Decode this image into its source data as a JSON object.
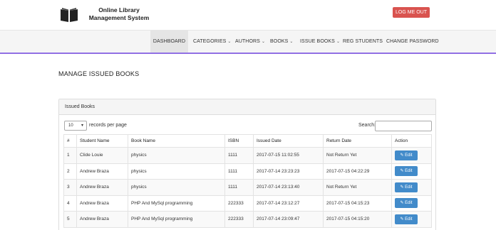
{
  "brand": {
    "title": "Online Library Management System",
    "logo_icon": "book-icon"
  },
  "header": {
    "logout_label": "LOG ME OUT",
    "logout_color": "#d9534f"
  },
  "menu": {
    "accent_color": "#9170e4",
    "items": [
      {
        "label": "DASHBOARD",
        "active": true,
        "dropdown": false
      },
      {
        "label": "CATEGORIES",
        "active": false,
        "dropdown": true
      },
      {
        "label": "AUTHORS",
        "active": false,
        "dropdown": true
      },
      {
        "label": "BOOKS",
        "active": false,
        "dropdown": true
      },
      {
        "label": "ISSUE BOOKS",
        "active": false,
        "dropdown": true
      },
      {
        "label": "REG STUDENTS",
        "active": false,
        "dropdown": false
      },
      {
        "label": "CHANGE PASSWORD",
        "active": false,
        "dropdown": false
      }
    ]
  },
  "page": {
    "title": "MANAGE ISSUED BOOKS"
  },
  "panel": {
    "heading": "Issued Books",
    "length_value": "10",
    "length_label": "records per page",
    "search_label": "Search:",
    "search_value": ""
  },
  "table": {
    "columns": [
      "#",
      "Student Name",
      "Book Name",
      "ISBN",
      "Issued Date",
      "Return Date",
      "Action"
    ],
    "rows": [
      {
        "num": "1",
        "student": "Clide Louie",
        "book": "physics",
        "isbn": "1111",
        "issued": "2017-07-15 11:02:55",
        "returned": "Not Return Yet",
        "action": "Edit"
      },
      {
        "num": "2",
        "student": "Andrew Braza",
        "book": "physics",
        "isbn": "1111",
        "issued": "2017-07-14 23:23:23",
        "returned": "2017-07-15 04:22:29",
        "action": "Edit"
      },
      {
        "num": "3",
        "student": "Andrew Braza",
        "book": "physics",
        "isbn": "1111",
        "issued": "2017-07-14 23:13:40",
        "returned": "Not Return Yet",
        "action": "Edit"
      },
      {
        "num": "4",
        "student": "Andrew Braza",
        "book": "PHP And MySql programming",
        "isbn": "222333",
        "issued": "2017-07-14 23:12:27",
        "returned": "2017-07-15 04:15:23",
        "action": "Edit"
      },
      {
        "num": "5",
        "student": "Andrew Braza",
        "book": "PHP And MySql programming",
        "isbn": "222333",
        "issued": "2017-07-14 23:09:47",
        "returned": "2017-07-15 04:15:20",
        "action": "Edit"
      }
    ],
    "edit_color": "#428bca"
  }
}
